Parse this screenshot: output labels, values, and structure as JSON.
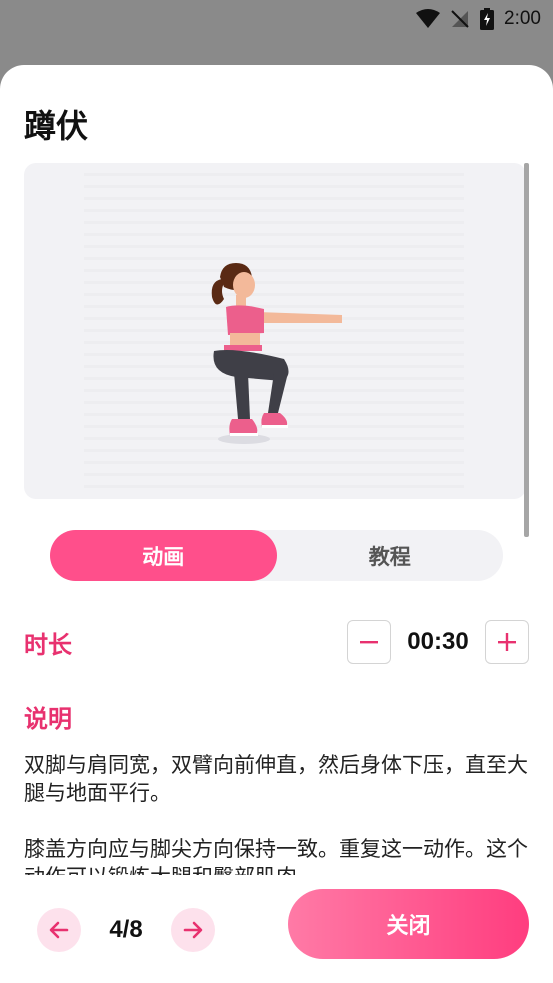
{
  "status_bar": {
    "time": "2:00",
    "icons": [
      "wifi-icon",
      "no-signal-icon",
      "battery-charging-icon"
    ]
  },
  "exercise": {
    "title": "蹲伏"
  },
  "tabs": [
    {
      "label": "动画",
      "active": true
    },
    {
      "label": "教程",
      "active": false
    }
  ],
  "duration": {
    "label": "时长",
    "value": "00:30"
  },
  "description": {
    "label": "说明",
    "paragraphs": [
      "双脚与肩同宽，双臂向前伸直，然后身体下压，直至大腿与地面平行。",
      "膝盖方向应与脚尖方向保持一致。重复这一动作。这个动作可以锻炼大腿和臀部肌肉。"
    ]
  },
  "pager": {
    "counter": "4/8"
  },
  "actions": {
    "close_label": "关闭"
  },
  "colors": {
    "accent": "#e8316f",
    "tab_active": "#ff4f8b",
    "nav_bg": "#fde1ec"
  }
}
